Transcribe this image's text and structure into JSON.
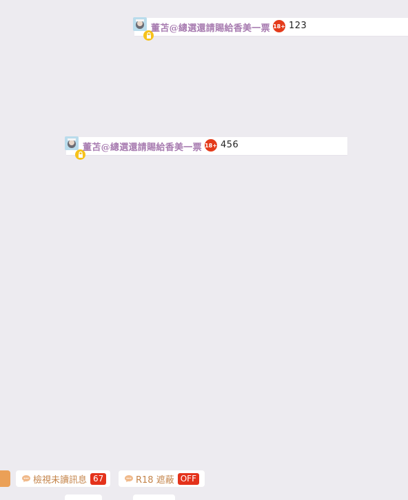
{
  "messages": [
    {
      "username": "董苫@總選還請賜給香美一票",
      "r18_badge": "18+",
      "text": "123",
      "locked": true
    },
    {
      "username": "董苫@總選還請賜給香美一票",
      "r18_badge": "18+",
      "text": "456",
      "locked": true
    }
  ],
  "bottom_bar": {
    "unread": {
      "label": "檢視未讀訊息",
      "count": "67",
      "icon": "chat-bubble-icon"
    },
    "r18_filter": {
      "label": "R18 遮蔽",
      "state": "OFF",
      "icon": "chat-bubble-icon"
    }
  },
  "colors": {
    "background": "#edebf0",
    "username": "#a77bb0",
    "r18_badge": "#e43b1b",
    "lock_badge": "#f6c21b",
    "pill_text": "#c4844a",
    "count_tag": "#e4321b",
    "orange_tab": "#eba057"
  }
}
